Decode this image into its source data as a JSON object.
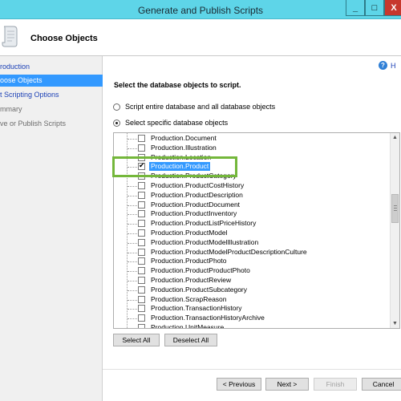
{
  "window": {
    "title": "Generate and Publish Scripts",
    "min_glyph": "_",
    "max_glyph": "□",
    "close_glyph": "X"
  },
  "header": {
    "title": "Choose Objects"
  },
  "nav": {
    "items": [
      {
        "label": "roduction",
        "state": "link"
      },
      {
        "label": "oose Objects",
        "state": "active"
      },
      {
        "label": "t Scripting Options",
        "state": "link"
      },
      {
        "label": "mmary",
        "state": "gray"
      },
      {
        "label": "ve or Publish Scripts",
        "state": "gray"
      }
    ]
  },
  "help": {
    "label": "H"
  },
  "main": {
    "prompt": "Select the database objects to script.",
    "options": [
      {
        "label": "Script entire database and all database objects",
        "checked": false
      },
      {
        "label": "Select specific database objects",
        "checked": true
      }
    ]
  },
  "tree": {
    "items": [
      {
        "label": "Production.Document",
        "checked": false,
        "selected": false
      },
      {
        "label": "Production.Illustration",
        "checked": false,
        "selected": false
      },
      {
        "label": "Production.Location",
        "checked": false,
        "selected": false
      },
      {
        "label": "Production.Product",
        "checked": true,
        "selected": true
      },
      {
        "label": "Production.ProductCategory",
        "checked": false,
        "selected": false
      },
      {
        "label": "Production.ProductCostHistory",
        "checked": false,
        "selected": false
      },
      {
        "label": "Production.ProductDescription",
        "checked": false,
        "selected": false
      },
      {
        "label": "Production.ProductDocument",
        "checked": false,
        "selected": false
      },
      {
        "label": "Production.ProductInventory",
        "checked": false,
        "selected": false
      },
      {
        "label": "Production.ProductListPriceHistory",
        "checked": false,
        "selected": false
      },
      {
        "label": "Production.ProductModel",
        "checked": false,
        "selected": false
      },
      {
        "label": "Production.ProductModelIllustration",
        "checked": false,
        "selected": false
      },
      {
        "label": "Production.ProductModelProductDescriptionCulture",
        "checked": false,
        "selected": false
      },
      {
        "label": "Production.ProductPhoto",
        "checked": false,
        "selected": false
      },
      {
        "label": "Production.ProductProductPhoto",
        "checked": false,
        "selected": false
      },
      {
        "label": "Production.ProductReview",
        "checked": false,
        "selected": false
      },
      {
        "label": "Production.ProductSubcategory",
        "checked": false,
        "selected": false
      },
      {
        "label": "Production.ScrapReason",
        "checked": false,
        "selected": false
      },
      {
        "label": "Production.TransactionHistory",
        "checked": false,
        "selected": false
      },
      {
        "label": "Production.TransactionHistoryArchive",
        "checked": false,
        "selected": false
      },
      {
        "label": "Production.UnitMeasure",
        "checked": false,
        "selected": false
      }
    ],
    "scroll_up_glyph": "▲",
    "scroll_down_glyph": "▼"
  },
  "buttons": {
    "select_all": "Select All",
    "deselect_all": "Deselect All",
    "previous": "< Previous",
    "next": "Next >",
    "finish": "Finish",
    "cancel": "Cancel"
  },
  "colors": {
    "titlebar": "#5ed5e8",
    "nav_active": "#3399ff",
    "highlight_box": "#74b73b",
    "close": "#c7382e"
  }
}
